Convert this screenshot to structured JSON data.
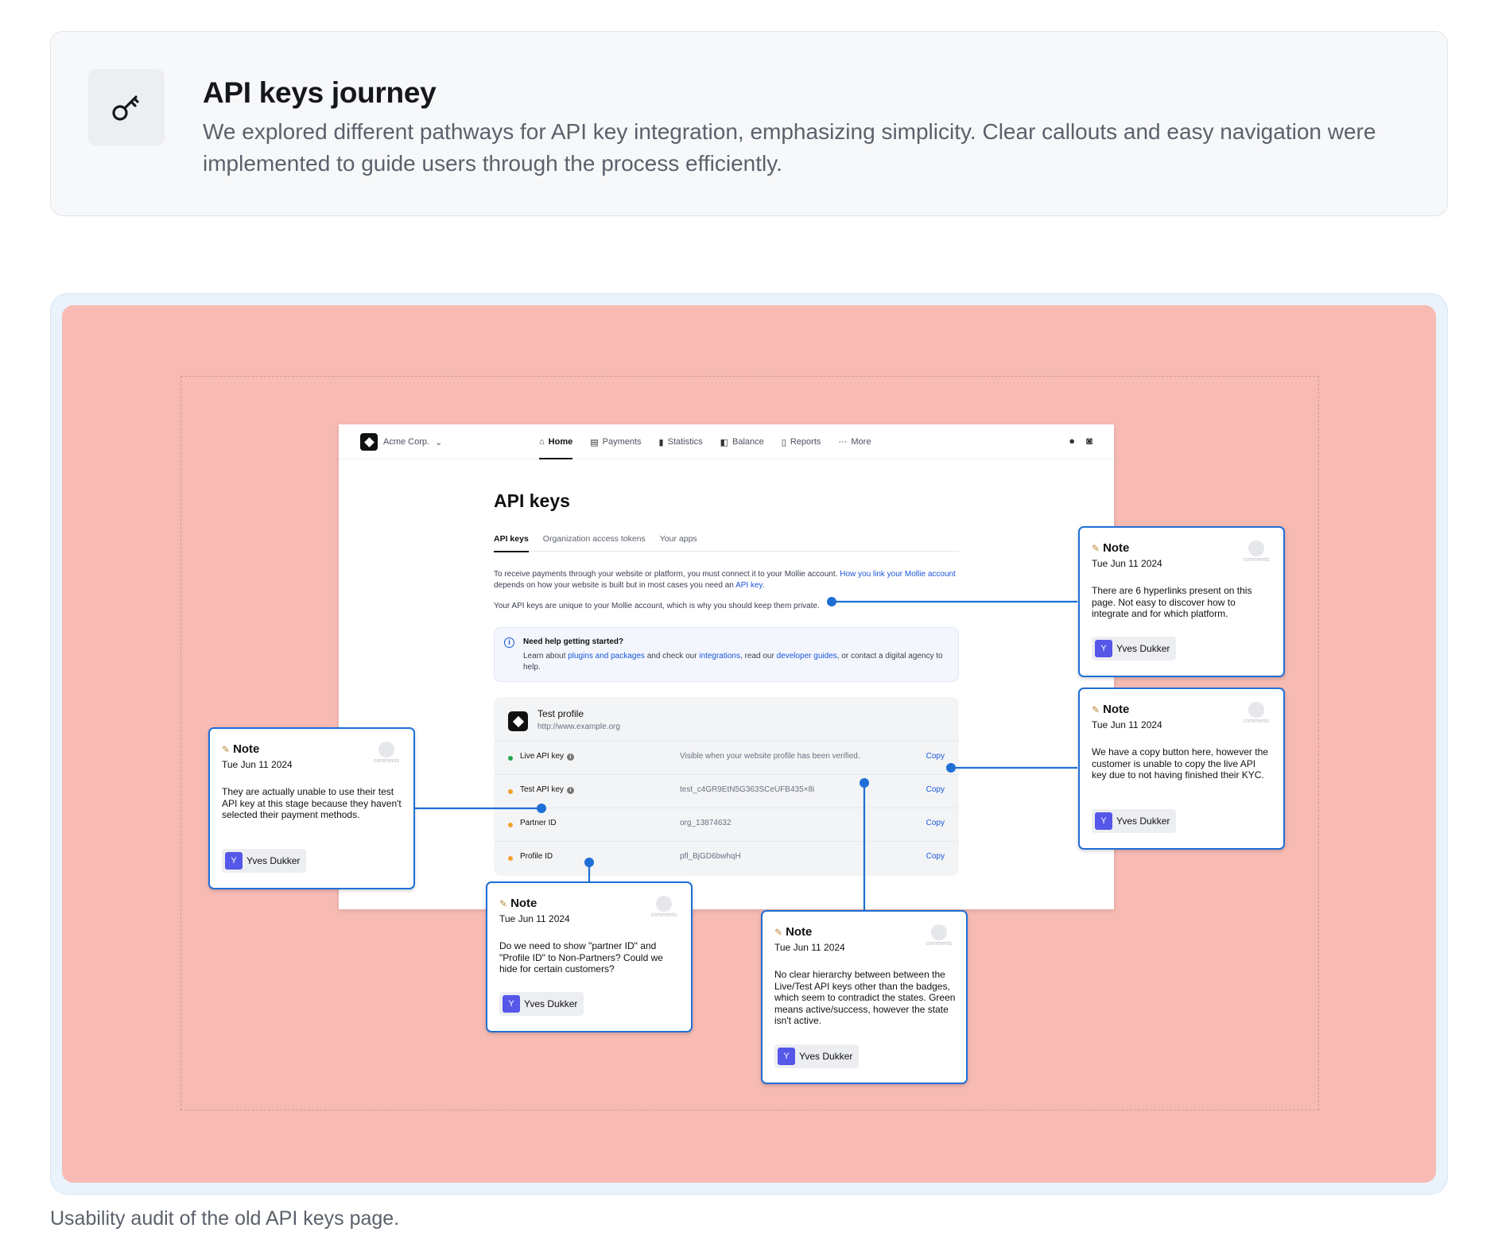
{
  "header": {
    "icon": "key-icon",
    "title": "API keys journey",
    "description": "We explored different pathways for API key integration, emphasizing simplicity. Clear callouts and easy navigation were implemented to guide users through the process efficiently."
  },
  "caption": "Usability audit of the old API keys page.",
  "colors": {
    "canvas": "#f7bbb4",
    "note_border": "#1f6fd6",
    "avatar": "#5557e8",
    "link": "#1a56db"
  },
  "mock": {
    "brand": "Acme Corp.",
    "nav": [
      {
        "label": "Home",
        "icon": "home-icon"
      },
      {
        "label": "Payments",
        "icon": "payments-icon"
      },
      {
        "label": "Statistics",
        "icon": "statistics-icon"
      },
      {
        "label": "Balance",
        "icon": "balance-icon"
      },
      {
        "label": "Reports",
        "icon": "reports-icon"
      },
      {
        "label": "More",
        "icon": "more-icon"
      }
    ],
    "title": "API keys",
    "tabs": [
      "API keys",
      "Organization access tokens",
      "Your apps"
    ],
    "intro": {
      "text1": "To receive payments through your website or platform, you must connect it to your Mollie account. ",
      "link1": "How you link your Mollie account",
      "text2": " depends on how your website is built but in most cases you need an ",
      "link2": "API key",
      "text3": "."
    },
    "intro2": "Your API keys are unique to your Mollie account, which is why you should keep them private.",
    "help": {
      "title": "Need help getting started?",
      "t1": "Learn about ",
      "l1": "plugins and packages",
      "t2": " and check our ",
      "l2": "integrations",
      "t3": ", read our ",
      "l3": "developer guides",
      "t4": ", or contact a digital agency to help."
    },
    "profile": {
      "name": "Test profile",
      "url": "http://www.example.org",
      "rows": [
        {
          "name": "Live API key",
          "value": "Visible when your website profile has been verified.",
          "copy": "Copy",
          "status": "green"
        },
        {
          "name": "Test API key",
          "value": "test_c4GR9EtN5G363SCeUFB435×8i",
          "copy": "Copy",
          "status": "orange"
        },
        {
          "name": "Partner ID",
          "value": "org_13874632",
          "copy": "Copy",
          "status": "orange"
        },
        {
          "name": "Profile ID",
          "value": "pfl_BjGD6bwhqH",
          "copy": "Copy",
          "status": "orange"
        }
      ]
    }
  },
  "notes": [
    {
      "label": "Note",
      "date": "Tue Jun 11 2024",
      "text": "There are 6 hyperlinks present on this page. Not easy to discover how to integrate and for which platform.",
      "comments": "comments",
      "author": "Yves Dukker",
      "initial": "Y"
    },
    {
      "label": "Note",
      "date": "Tue Jun 11 2024",
      "text": "We have a copy button here, however the customer is unable to copy the live API key due to not having finished their KYC.",
      "comments": "comments",
      "author": "Yves Dukker",
      "initial": "Y"
    },
    {
      "label": "Note",
      "date": "Tue Jun 11 2024",
      "text": "They are actually unable to use their test API key at this stage because they haven't selected their payment methods.",
      "comments": "comments",
      "author": "Yves Dukker",
      "initial": "Y"
    },
    {
      "label": "Note",
      "date": "Tue Jun 11 2024",
      "text": "Do we need to show \"partner ID\" and \"Profile ID\" to Non-Partners? Could we hide for certain customers?",
      "comments": "comments",
      "author": "Yves Dukker",
      "initial": "Y"
    },
    {
      "label": "Note",
      "date": "Tue Jun 11 2024",
      "text": "No clear hierarchy between between the Live/Test API keys other than the badges, which seem to contradict the states. Green means active/success, however the state isn't active.",
      "comments": "comments",
      "author": "Yves Dukker",
      "initial": "Y"
    }
  ]
}
